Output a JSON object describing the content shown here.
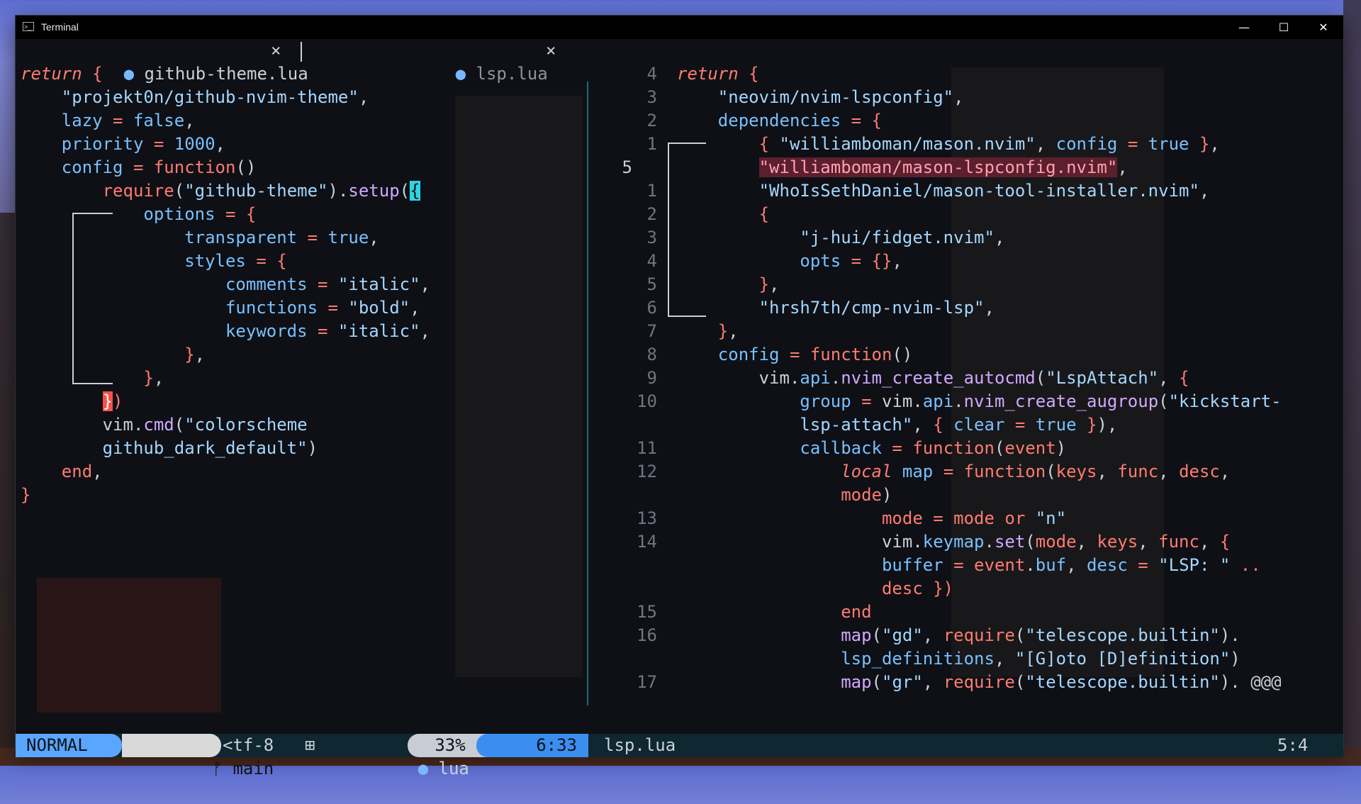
{
  "window": {
    "title": "Terminal"
  },
  "tabs": [
    {
      "label": "github-theme.lua",
      "close": "×"
    },
    {
      "label": "lsp.lua",
      "close": "×"
    }
  ],
  "left_lines": [
    [
      [
        "kwi",
        "return"
      ],
      [
        "pl",
        " "
      ],
      [
        "brk",
        "{"
      ]
    ],
    [
      [
        "pl",
        "    "
      ],
      [
        "str",
        "\"projekt0n/github-nvim-theme\""
      ],
      [
        "pl",
        ","
      ]
    ],
    [
      [
        "pl",
        "    "
      ],
      [
        "id",
        "lazy"
      ],
      [
        "op",
        " = "
      ],
      [
        "num",
        "false"
      ],
      [
        "pl",
        ","
      ]
    ],
    [
      [
        "pl",
        "    "
      ],
      [
        "id",
        "priority"
      ],
      [
        "op",
        " = "
      ],
      [
        "num",
        "1000"
      ],
      [
        "pl",
        ","
      ]
    ],
    [
      [
        "pl",
        "    "
      ],
      [
        "id",
        "config"
      ],
      [
        "op",
        " = "
      ],
      [
        "kw",
        "function"
      ],
      [
        "pl",
        "()"
      ]
    ],
    [
      [
        "pl",
        "        "
      ],
      [
        "kw",
        "require"
      ],
      [
        "pl",
        "("
      ],
      [
        "str",
        "\"github-theme\""
      ],
      [
        "pl",
        ")."
      ],
      [
        "fn",
        "setup"
      ],
      [
        "pl",
        "("
      ],
      [
        "cursor",
        "{"
      ]
    ],
    [
      [
        "pl",
        "            "
      ],
      [
        "id",
        "options"
      ],
      [
        "op",
        " = "
      ],
      [
        "brk",
        "{"
      ]
    ],
    [
      [
        "pl",
        "                "
      ],
      [
        "id",
        "transparent"
      ],
      [
        "op",
        " = "
      ],
      [
        "num",
        "true"
      ],
      [
        "pl",
        ","
      ]
    ],
    [
      [
        "pl",
        "                "
      ],
      [
        "id",
        "styles"
      ],
      [
        "op",
        " = "
      ],
      [
        "brk",
        "{"
      ]
    ],
    [
      [
        "pl",
        "                    "
      ],
      [
        "id",
        "comments"
      ],
      [
        "op",
        " = "
      ],
      [
        "str",
        "\"italic\""
      ],
      [
        "pl",
        ","
      ]
    ],
    [
      [
        "pl",
        "                    "
      ],
      [
        "id",
        "functions"
      ],
      [
        "op",
        " = "
      ],
      [
        "str",
        "\"bold\""
      ],
      [
        "pl",
        ","
      ]
    ],
    [
      [
        "pl",
        "                    "
      ],
      [
        "id",
        "keywords"
      ],
      [
        "op",
        " = "
      ],
      [
        "str",
        "\"italic\""
      ],
      [
        "pl",
        ","
      ]
    ],
    [
      [
        "pl",
        "                "
      ],
      [
        "brk",
        "}"
      ],
      [
        "pl",
        ","
      ]
    ],
    [
      [
        "pl",
        "            "
      ],
      [
        "brk",
        "}"
      ],
      [
        "pl",
        ","
      ]
    ],
    [
      [
        "pl",
        "        "
      ],
      [
        "mbrk",
        "}"
      ],
      [
        "kw",
        ")"
      ]
    ],
    [
      [
        "pl",
        "        "
      ],
      [
        "pl",
        "vim"
      ],
      [
        "pl",
        "."
      ],
      [
        "fn",
        "cmd"
      ],
      [
        "pl",
        "("
      ],
      [
        "str",
        "\"colorscheme"
      ]
    ],
    [
      [
        "str",
        "        github_dark_default\""
      ],
      [
        "pl",
        ")"
      ]
    ],
    [
      [
        "pl",
        "    "
      ],
      [
        "kw",
        "end"
      ],
      [
        "pl",
        ","
      ]
    ],
    [
      [
        "brk",
        "}"
      ]
    ]
  ],
  "right_lines": [
    {
      "n": "4",
      "t": [
        [
          "kwi",
          "return"
        ],
        [
          "pl",
          " "
        ],
        [
          "brk",
          "{"
        ]
      ]
    },
    {
      "n": "3",
      "t": [
        [
          "pl",
          "    "
        ],
        [
          "str",
          "\"neovim/nvim-lspconfig\""
        ],
        [
          "pl",
          ","
        ]
      ]
    },
    {
      "n": "2",
      "t": [
        [
          "pl",
          "    "
        ],
        [
          "id",
          "dependencies"
        ],
        [
          "op",
          " = "
        ],
        [
          "brk",
          "{"
        ]
      ]
    },
    {
      "n": "1",
      "t": [
        [
          "pl",
          "        "
        ],
        [
          "brk",
          "{ "
        ],
        [
          "str",
          "\"williamboman/mason.nvim\""
        ],
        [
          "pl",
          ", "
        ],
        [
          "id",
          "config"
        ],
        [
          "op",
          " = "
        ],
        [
          "num",
          "true"
        ],
        [
          "brk",
          " }"
        ],
        [
          "pl",
          ","
        ]
      ]
    },
    {
      "n": "5",
      "cur": true,
      "t": [
        [
          "pl",
          "        "
        ],
        [
          "hl",
          "\"williamboman/mason-lspconfig.nvim\""
        ],
        [
          "pl",
          ","
        ]
      ]
    },
    {
      "n": "1",
      "t": [
        [
          "pl",
          "        "
        ],
        [
          "str",
          "\"WhoIsSethDaniel/mason-tool-installer.nvim\""
        ],
        [
          "pl",
          ","
        ]
      ]
    },
    {
      "n": "2",
      "t": [
        [
          "pl",
          "        "
        ],
        [
          "brk",
          "{"
        ]
      ]
    },
    {
      "n": "3",
      "t": [
        [
          "pl",
          "            "
        ],
        [
          "str",
          "\"j-hui/fidget.nvim\""
        ],
        [
          "pl",
          ","
        ]
      ]
    },
    {
      "n": "4",
      "t": [
        [
          "pl",
          "            "
        ],
        [
          "id",
          "opts"
        ],
        [
          "op",
          " = "
        ],
        [
          "brk",
          "{}"
        ],
        [
          "pl",
          ","
        ]
      ]
    },
    {
      "n": "5",
      "t": [
        [
          "pl",
          "        "
        ],
        [
          "brk",
          "}"
        ],
        [
          "pl",
          ","
        ]
      ]
    },
    {
      "n": "6",
      "t": [
        [
          "pl",
          "        "
        ],
        [
          "str",
          "\"hrsh7th/cmp-nvim-lsp\""
        ],
        [
          "pl",
          ","
        ]
      ]
    },
    {
      "n": "7",
      "t": [
        [
          "pl",
          "    "
        ],
        [
          "brk",
          "}"
        ],
        [
          "pl",
          ","
        ]
      ]
    },
    {
      "n": "8",
      "t": [
        [
          "pl",
          "    "
        ],
        [
          "id",
          "config"
        ],
        [
          "op",
          " = "
        ],
        [
          "kw",
          "function"
        ],
        [
          "pl",
          "()"
        ]
      ]
    },
    {
      "n": "9",
      "t": [
        [
          "pl",
          "        vim."
        ],
        [
          "id",
          "api"
        ],
        [
          "pl",
          "."
        ],
        [
          "fn",
          "nvim_create_autocmd"
        ],
        [
          "pl",
          "("
        ],
        [
          "str",
          "\"LspAttach\""
        ],
        [
          "pl",
          ", "
        ],
        [
          "brk",
          "{"
        ]
      ]
    },
    {
      "n": "10",
      "t": [
        [
          "pl",
          "            "
        ],
        [
          "id",
          "group"
        ],
        [
          "op",
          " = "
        ],
        [
          "pl",
          "vim."
        ],
        [
          "id",
          "api"
        ],
        [
          "pl",
          "."
        ],
        [
          "fn",
          "nvim_create_augroup"
        ],
        [
          "pl",
          "("
        ],
        [
          "str",
          "\"kickstart-"
        ]
      ]
    },
    {
      "n": "",
      "t": [
        [
          "str",
          "            lsp-attach\""
        ],
        [
          "pl",
          ", "
        ],
        [
          "brk",
          "{ "
        ],
        [
          "id",
          "clear"
        ],
        [
          "op",
          " = "
        ],
        [
          "num",
          "true"
        ],
        [
          "brk",
          " }"
        ],
        [
          "pl",
          "),"
        ]
      ]
    },
    {
      "n": "11",
      "t": [
        [
          "pl",
          "            "
        ],
        [
          "id",
          "callback"
        ],
        [
          "op",
          " = "
        ],
        [
          "kw",
          "function"
        ],
        [
          "pl",
          "("
        ],
        [
          "kw",
          "event"
        ],
        [
          "pl",
          ")"
        ]
      ]
    },
    {
      "n": "12",
      "t": [
        [
          "pl",
          "                "
        ],
        [
          "kwi",
          "local"
        ],
        [
          "pl",
          " "
        ],
        [
          "id",
          "map"
        ],
        [
          "op",
          " = "
        ],
        [
          "kw",
          "function"
        ],
        [
          "pl",
          "("
        ],
        [
          "kw",
          "keys"
        ],
        [
          "pl",
          ", "
        ],
        [
          "kw",
          "func"
        ],
        [
          "pl",
          ", "
        ],
        [
          "kw",
          "desc"
        ],
        [
          "pl",
          ","
        ]
      ]
    },
    {
      "n": "",
      "t": [
        [
          "kw",
          "                mode"
        ],
        [
          "pl",
          ")"
        ]
      ]
    },
    {
      "n": "13",
      "t": [
        [
          "pl",
          "                    "
        ],
        [
          "kw",
          "mode"
        ],
        [
          "op",
          " = "
        ],
        [
          "kw",
          "mode"
        ],
        [
          "op",
          " or "
        ],
        [
          "str",
          "\"n\""
        ]
      ]
    },
    {
      "n": "14",
      "t": [
        [
          "pl",
          "                    vim."
        ],
        [
          "id",
          "keymap"
        ],
        [
          "pl",
          "."
        ],
        [
          "fn",
          "set"
        ],
        [
          "pl",
          "("
        ],
        [
          "kw",
          "mode"
        ],
        [
          "pl",
          ", "
        ],
        [
          "kw",
          "keys"
        ],
        [
          "pl",
          ", "
        ],
        [
          "kw",
          "func"
        ],
        [
          "pl",
          ", "
        ],
        [
          "brk",
          "{"
        ]
      ]
    },
    {
      "n": "",
      "t": [
        [
          "pl",
          "                    "
        ],
        [
          "id",
          "buffer"
        ],
        [
          "op",
          " = "
        ],
        [
          "kw",
          "event"
        ],
        [
          "pl",
          "."
        ],
        [
          "id",
          "buf"
        ],
        [
          "pl",
          ", "
        ],
        [
          "id",
          "desc"
        ],
        [
          "op",
          " = "
        ],
        [
          "str",
          "\"LSP: \""
        ],
        [
          "op",
          " .."
        ]
      ]
    },
    {
      "n": "",
      "t": [
        [
          "kw",
          "                    desc"
        ],
        [
          "brk",
          " })"
        ]
      ]
    },
    {
      "n": "15",
      "t": [
        [
          "pl",
          "                "
        ],
        [
          "kw",
          "end"
        ]
      ]
    },
    {
      "n": "16",
      "t": [
        [
          "pl",
          "                "
        ],
        [
          "fn",
          "map"
        ],
        [
          "pl",
          "("
        ],
        [
          "str",
          "\"gd\""
        ],
        [
          "pl",
          ", "
        ],
        [
          "kw",
          "require"
        ],
        [
          "pl",
          "("
        ],
        [
          "str",
          "\"telescope.builtin\""
        ],
        [
          "pl",
          ")."
        ]
      ]
    },
    {
      "n": "",
      "t": [
        [
          "id",
          "                lsp_definitions"
        ],
        [
          "pl",
          ", "
        ],
        [
          "str",
          "\"[G]oto [D]efinition\""
        ],
        [
          "pl",
          ")"
        ]
      ]
    },
    {
      "n": "17",
      "t": [
        [
          "pl",
          "                "
        ],
        [
          "fn",
          "map"
        ],
        [
          "pl",
          "("
        ],
        [
          "str",
          "\"gr\""
        ],
        [
          "pl",
          ", "
        ],
        [
          "kw",
          "require"
        ],
        [
          "pl",
          "("
        ],
        [
          "str",
          "\"telescope.builtin\""
        ],
        [
          "pl",
          ")."
        ],
        [
          "pl",
          " @@@"
        ]
      ]
    }
  ],
  "status": {
    "mode": "NORMAL",
    "branch_icon": "ᚠ",
    "branch": "main",
    "encoding": "<tf-8",
    "os_icon": "⊞",
    "filetype_icon": "●",
    "filetype": "lua",
    "percent": "33%",
    "position": "6:33",
    "right_file": "lsp.lua",
    "right_position": "5:4"
  },
  "colors": {
    "mode_bg": "#58a6ff",
    "branch_bg": "#30363d",
    "percent_bg": "#8b949e",
    "pos_bg": "#58a6ff",
    "statusline_bg": "#0e2730"
  }
}
